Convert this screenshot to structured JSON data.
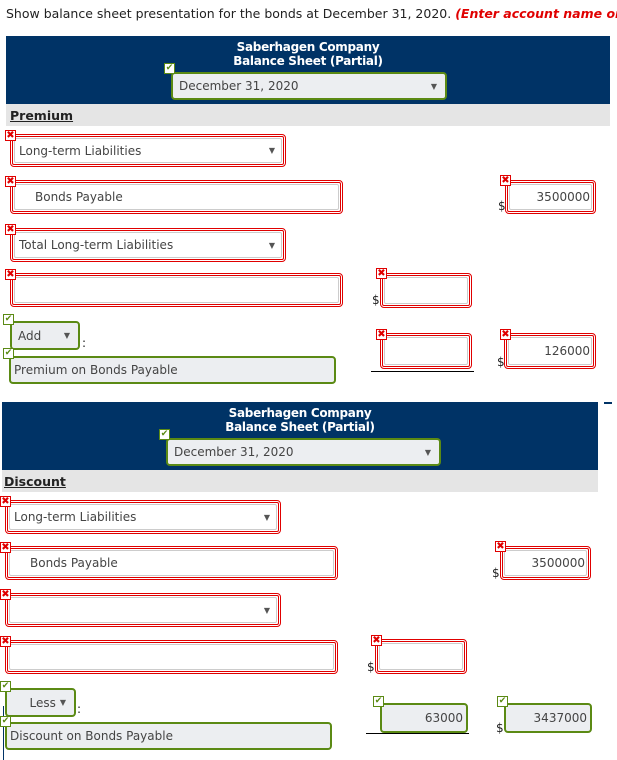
{
  "instruction": {
    "text": "Show balance sheet presentation for the bonds at December 31, 2020. ",
    "emphasis": "(Enter account name only"
  },
  "premium": {
    "company": "Saberhagen Company",
    "statement": "Balance Sheet (Partial)",
    "date_select": "December 31, 2020",
    "section_label": "Premium",
    "rows": {
      "heading_select": "Long-term Liabilities",
      "bonds_label": "Bonds Payable",
      "bonds_amount": "3500000",
      "total_select": "Total Long-term Liabilities",
      "blank_label": "",
      "blank_amount": "",
      "adjust_select": "Add",
      "adjust_colon": ":",
      "adjust_label": "Premium on Bonds Payable",
      "adjust_amount": "",
      "carrying_amount": "126000"
    }
  },
  "discount": {
    "company": "Saberhagen Company",
    "statement": "Balance Sheet (Partial)",
    "date_select": "December 31, 2020",
    "section_label": "Discount",
    "rows": {
      "heading_select": "Long-term Liabilities",
      "bonds_label": "Bonds Payable",
      "bonds_amount": "3500000",
      "blank_select": "",
      "blank_label": "",
      "blank_amount": "",
      "adjust_select": "Less",
      "adjust_colon": ":",
      "adjust_label": "Discount on Bonds Payable",
      "adjust_amount": "63000",
      "carrying_amount": "3437000"
    }
  },
  "symbols": {
    "currency": "$",
    "wrong": "✖",
    "correct": "✔",
    "dropdown": "▼"
  }
}
